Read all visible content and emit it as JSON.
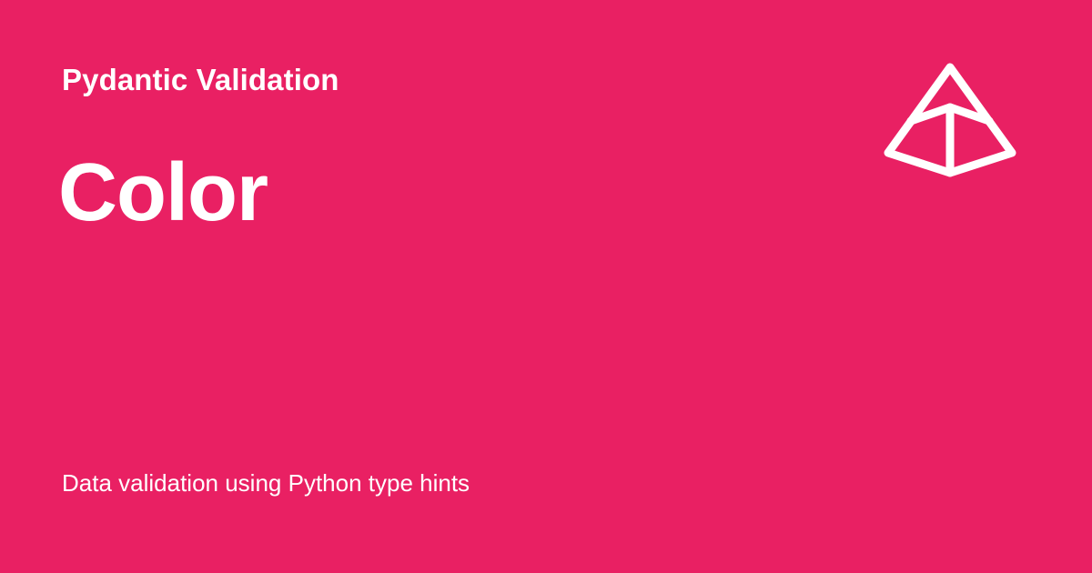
{
  "header": {
    "site_name": "Pydantic Validation"
  },
  "main": {
    "title": "Color",
    "description": "Data validation using Python type hints"
  },
  "logo": {
    "icon": "pydantic-logo-icon"
  },
  "colors": {
    "background": "#E92063",
    "foreground": "#FFFFFF"
  }
}
